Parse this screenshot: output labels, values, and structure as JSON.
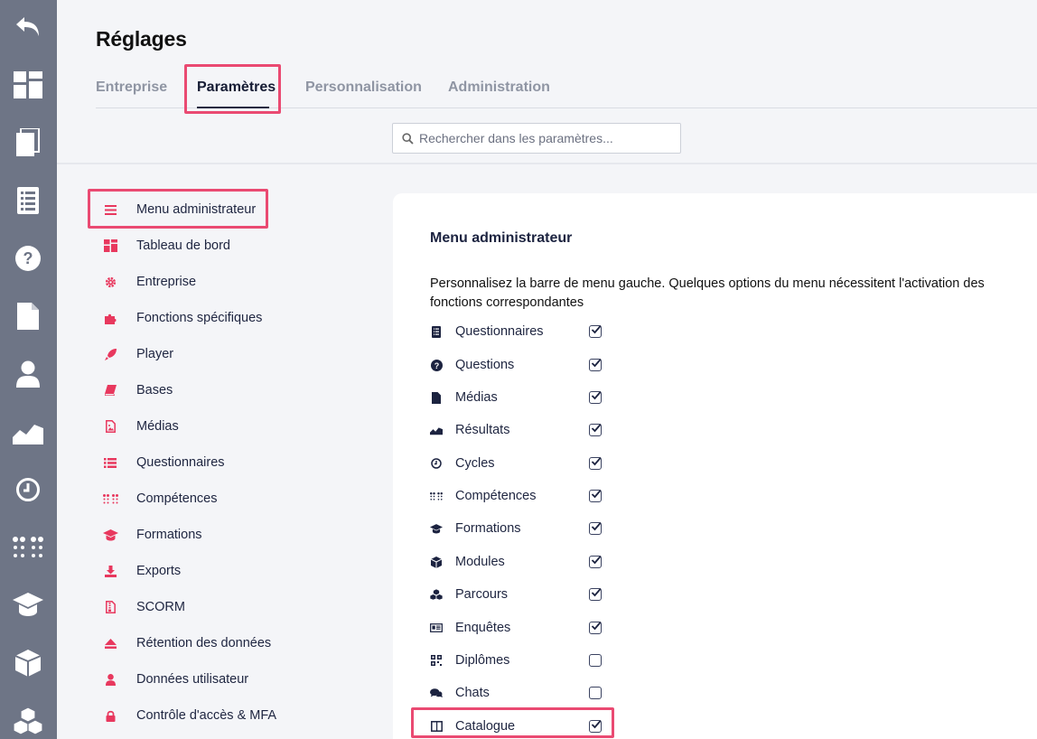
{
  "header": {
    "title": "Réglages",
    "tabs": [
      {
        "label": "Entreprise"
      },
      {
        "label": "Paramètres"
      },
      {
        "label": "Personnalisation"
      },
      {
        "label": "Administration"
      }
    ],
    "active_tab": "Paramètres"
  },
  "search": {
    "placeholder": "Rechercher dans les paramètres..."
  },
  "rail_icons": [
    "undo-icon",
    "dashboard-icon",
    "copy-icon",
    "list-icon",
    "help-icon",
    "file-icon",
    "user-icon",
    "chart-icon",
    "clock-icon",
    "dots-grid-icon",
    "graduation-cap-icon",
    "cube-icon",
    "cubes-icon"
  ],
  "sidebar": {
    "items": [
      {
        "label": "Menu administrateur",
        "icon": "bars-icon"
      },
      {
        "label": "Tableau de bord",
        "icon": "dashboard-icon"
      },
      {
        "label": "Entreprise",
        "icon": "gear-icon"
      },
      {
        "label": "Fonctions spécifiques",
        "icon": "puzzle-icon"
      },
      {
        "label": "Player",
        "icon": "rocket-icon"
      },
      {
        "label": "Bases",
        "icon": "book-icon"
      },
      {
        "label": "Médias",
        "icon": "image-file-icon"
      },
      {
        "label": "Questionnaires",
        "icon": "list-icon"
      },
      {
        "label": "Compétences",
        "icon": "dots-grid-icon"
      },
      {
        "label": "Formations",
        "icon": "graduation-cap-icon"
      },
      {
        "label": "Exports",
        "icon": "download-icon"
      },
      {
        "label": "SCORM",
        "icon": "zip-file-icon"
      },
      {
        "label": "Rétention des données",
        "icon": "eject-icon"
      },
      {
        "label": "Données utilisateur",
        "icon": "user-icon"
      },
      {
        "label": "Contrôle d'accès & MFA",
        "icon": "lock-icon"
      }
    ],
    "accent_color": "#e8385e"
  },
  "panel": {
    "title": "Menu administrateur",
    "description": "Personnalisez la barre de menu gauche. Quelques options du menu nécessitent l'activation des fonctions correspondantes",
    "options": [
      {
        "label": "Questionnaires",
        "icon": "list-icon",
        "checked": true
      },
      {
        "label": "Questions",
        "icon": "help-icon",
        "checked": true
      },
      {
        "label": "Médias",
        "icon": "file-icon",
        "checked": true
      },
      {
        "label": "Résultats",
        "icon": "chart-icon",
        "checked": true
      },
      {
        "label": "Cycles",
        "icon": "clock-icon",
        "checked": true
      },
      {
        "label": "Compétences",
        "icon": "dots-grid-icon",
        "checked": true
      },
      {
        "label": "Formations",
        "icon": "graduation-cap-icon",
        "checked": true
      },
      {
        "label": "Modules",
        "icon": "cube-icon",
        "checked": true
      },
      {
        "label": "Parcours",
        "icon": "cubes-icon",
        "checked": true
      },
      {
        "label": "Enquêtes",
        "icon": "newspaper-icon",
        "checked": true
      },
      {
        "label": "Diplômes",
        "icon": "qrcode-icon",
        "checked": false
      },
      {
        "label": "Chats",
        "icon": "comments-icon",
        "checked": false
      },
      {
        "label": "Catalogue",
        "icon": "columns-icon",
        "checked": true
      }
    ]
  },
  "colors": {
    "rail": "#6e7586",
    "accent": "#e8385e",
    "highlight": "#ea4a72",
    "text_dark": "#1c2340"
  }
}
